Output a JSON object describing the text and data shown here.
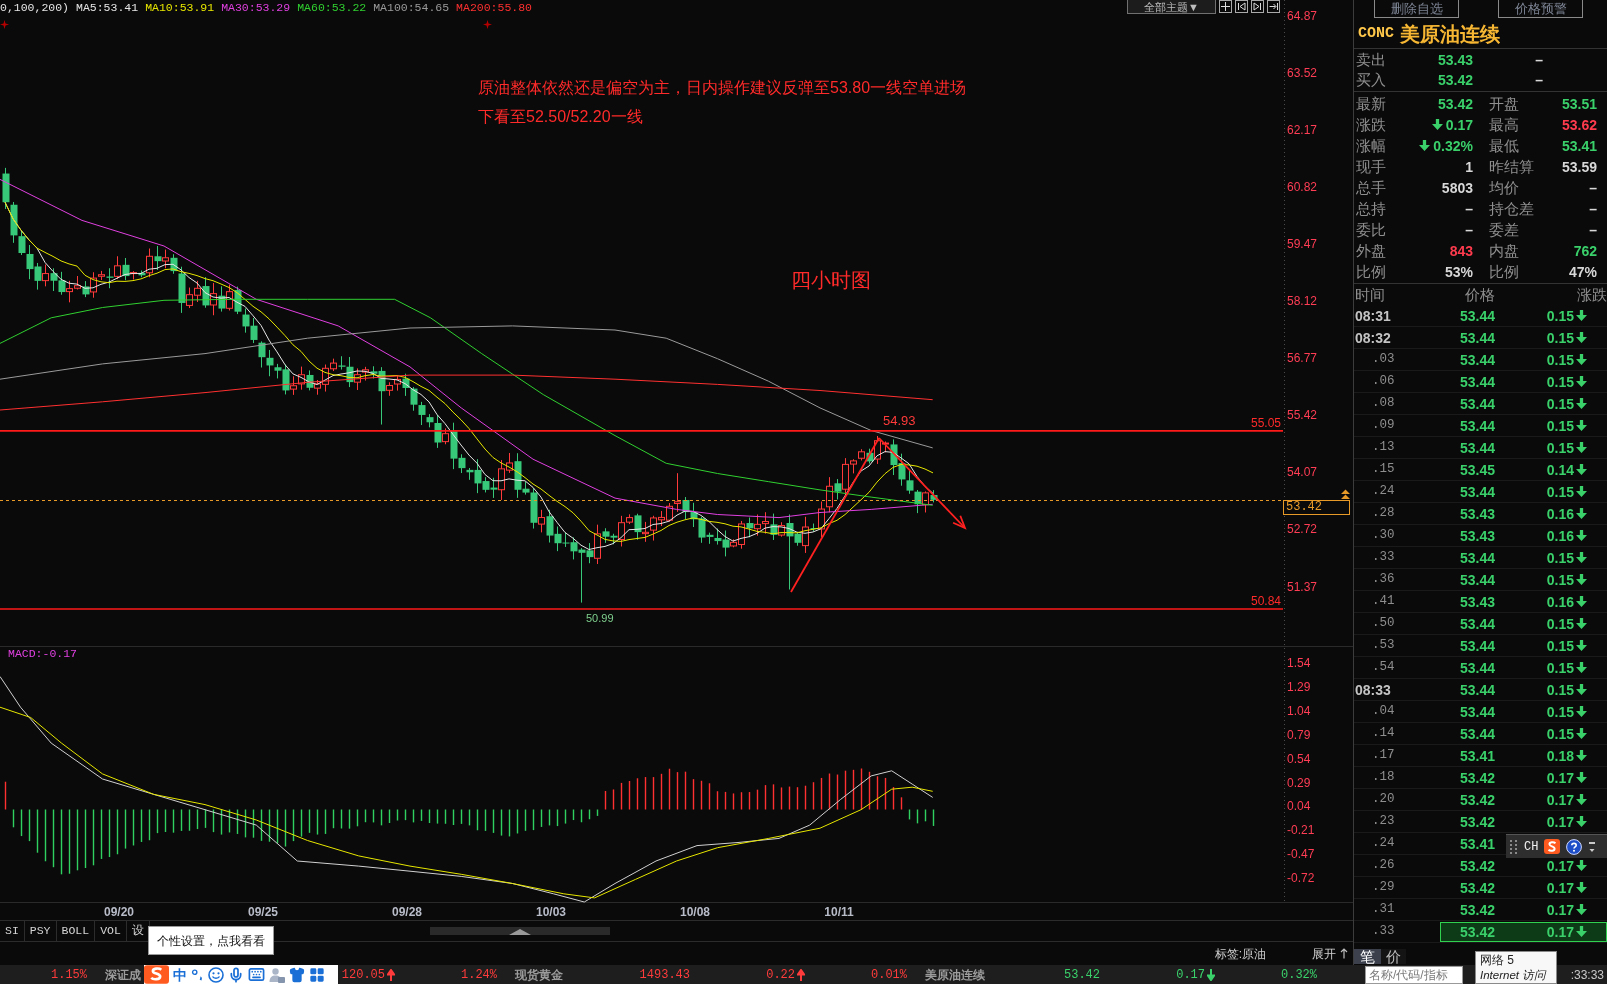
{
  "chart_header": {
    "params": "0,100,200)",
    "moving_averages": [
      {
        "label": "MA5:53.41",
        "color": "#e6e6e6"
      },
      {
        "label": "MA10:53.91",
        "color": "#e6e600"
      },
      {
        "label": "MA30:53.29",
        "color": "#e040e0"
      },
      {
        "label": "MA60:53.22",
        "color": "#30d030"
      },
      {
        "label": "MA100:54.65",
        "color": "#9a9a9a"
      },
      {
        "label": "MA200:55.80",
        "color": "#ff3030"
      }
    ],
    "theme_button": "全部主题▼"
  },
  "notes": [
    "原油整体依然还是偏空为主，日内操作建议反弹至53.80一线空单进场",
    "下看至52.50/52.20一线"
  ],
  "chart_title": "四小时图",
  "price_axis": [
    "64.87",
    "63.52",
    "62.17",
    "60.82",
    "59.47",
    "58.12",
    "56.77",
    "55.42",
    "54.07",
    "52.72",
    "51.37"
  ],
  "levels": [
    {
      "label": "55.05",
      "kind": "resistance"
    },
    {
      "label": "50.84",
      "kind": "support"
    }
  ],
  "extremes": {
    "high": "54.93",
    "low": "50.99"
  },
  "last_price": "53.42",
  "macd": {
    "label": "MACD:-0.17",
    "axis": [
      "1.54",
      "1.29",
      "1.04",
      "0.79",
      "0.54",
      "0.29",
      "0.04",
      "-0.21",
      "-0.47",
      "-0.72"
    ]
  },
  "dates": [
    "09/20",
    "09/25",
    "09/28",
    "10/03",
    "10/08",
    "10/11"
  ],
  "indicator_tabs": [
    "SI",
    "PSY",
    "BOLL",
    "VOL",
    "设"
  ],
  "settings_tooltip": "个性设置，点我看看",
  "tag_label": "标签:原油",
  "expand_button": "展开",
  "quote_panel": {
    "buttons": [
      "删除自选",
      "价格预警"
    ],
    "code": "CONC",
    "name": "美原油连续",
    "book": [
      {
        "label": "卖出",
        "price": "53.43",
        "volume": "–",
        "color": "#3ad16b"
      },
      {
        "label": "买入",
        "price": "53.42",
        "volume": "–",
        "color": "#3ad16b"
      }
    ],
    "stats": [
      {
        "left": {
          "label": "最新",
          "value": "53.42",
          "color": "#3ad16b",
          "arrow": false
        },
        "right": {
          "label": "开盘",
          "value": "53.51",
          "color": "#3ad16b",
          "arrow": false
        }
      },
      {
        "left": {
          "label": "涨跌",
          "value": "0.17",
          "color": "#3ad16b",
          "arrow": true
        },
        "right": {
          "label": "最高",
          "value": "53.62",
          "color": "#ff3b4e",
          "arrow": false
        }
      },
      {
        "left": {
          "label": "涨幅",
          "value": "0.32%",
          "color": "#3ad16b",
          "arrow": true
        },
        "right": {
          "label": "最低",
          "value": "53.41",
          "color": "#3ad16b",
          "arrow": false
        }
      },
      {
        "left": {
          "label": "现手",
          "value": "1",
          "color": "#d8d8d8",
          "arrow": false
        },
        "right": {
          "label": "昨结算",
          "value": "53.59",
          "color": "#d8d8d8",
          "arrow": false
        }
      },
      {
        "left": {
          "label": "总手",
          "value": "5803",
          "color": "#d8d8d8",
          "arrow": false
        },
        "right": {
          "label": "均价",
          "value": "–",
          "color": "#d8d8d8",
          "arrow": false
        }
      },
      {
        "left": {
          "label": "总持",
          "value": "–",
          "color": "#d8d8d8",
          "arrow": false
        },
        "right": {
          "label": "持仓差",
          "value": "–",
          "color": "#d8d8d8",
          "arrow": false
        }
      },
      {
        "left": {
          "label": "委比",
          "value": "–",
          "color": "#d8d8d8",
          "arrow": false
        },
        "right": {
          "label": "委差",
          "value": "–",
          "color": "#d8d8d8",
          "arrow": false
        }
      },
      {
        "left": {
          "label": "外盘",
          "value": "843",
          "color": "#ff3b4e",
          "arrow": false
        },
        "right": {
          "label": "内盘",
          "value": "762",
          "color": "#3ad16b",
          "arrow": false
        }
      },
      {
        "left": {
          "label": "比例",
          "value": "53%",
          "color": "#d8d8d8",
          "arrow": false
        },
        "right": {
          "label": "比例",
          "value": "47%",
          "color": "#d8d8d8",
          "arrow": false
        }
      }
    ]
  },
  "tape": {
    "columns": [
      "时间",
      "价格",
      "涨跌"
    ],
    "rows": [
      {
        "time": "08:31",
        "kind": "minute",
        "price": "53.44",
        "change": "0.15",
        "color": "#3ad16b",
        "rising": false,
        "selected": false
      },
      {
        "time": "08:32",
        "kind": "minute",
        "price": "53.44",
        "change": "0.15",
        "color": "#3ad16b",
        "rising": false,
        "selected": false
      },
      {
        "time": ".03",
        "kind": "tick",
        "price": "53.44",
        "change": "0.15",
        "color": "#3ad16b",
        "rising": false,
        "selected": false
      },
      {
        "time": ".06",
        "kind": "tick",
        "price": "53.44",
        "change": "0.15",
        "color": "#3ad16b",
        "rising": false,
        "selected": false
      },
      {
        "time": ".08",
        "kind": "tick",
        "price": "53.44",
        "change": "0.15",
        "color": "#3ad16b",
        "rising": false,
        "selected": false
      },
      {
        "time": ".09",
        "kind": "tick",
        "price": "53.44",
        "change": "0.15",
        "color": "#3ad16b",
        "rising": false,
        "selected": false
      },
      {
        "time": ".13",
        "kind": "tick",
        "price": "53.44",
        "change": "0.15",
        "color": "#3ad16b",
        "rising": false,
        "selected": false
      },
      {
        "time": ".15",
        "kind": "tick",
        "price": "53.45",
        "change": "0.14",
        "color": "#3ad16b",
        "rising": false,
        "selected": false
      },
      {
        "time": ".24",
        "kind": "tick",
        "price": "53.44",
        "change": "0.15",
        "color": "#3ad16b",
        "rising": false,
        "selected": false
      },
      {
        "time": ".28",
        "kind": "tick",
        "price": "53.43",
        "change": "0.16",
        "color": "#3ad16b",
        "rising": false,
        "selected": false
      },
      {
        "time": ".30",
        "kind": "tick",
        "price": "53.43",
        "change": "0.16",
        "color": "#3ad16b",
        "rising": false,
        "selected": false
      },
      {
        "time": ".33",
        "kind": "tick",
        "price": "53.44",
        "change": "0.15",
        "color": "#3ad16b",
        "rising": false,
        "selected": false
      },
      {
        "time": ".36",
        "kind": "tick",
        "price": "53.44",
        "change": "0.15",
        "color": "#3ad16b",
        "rising": false,
        "selected": false
      },
      {
        "time": ".41",
        "kind": "tick",
        "price": "53.43",
        "change": "0.16",
        "color": "#3ad16b",
        "rising": false,
        "selected": false
      },
      {
        "time": ".50",
        "kind": "tick",
        "price": "53.44",
        "change": "0.15",
        "color": "#3ad16b",
        "rising": false,
        "selected": false
      },
      {
        "time": ".53",
        "kind": "tick",
        "price": "53.44",
        "change": "0.15",
        "color": "#3ad16b",
        "rising": false,
        "selected": false
      },
      {
        "time": ".54",
        "kind": "tick",
        "price": "53.44",
        "change": "0.15",
        "color": "#3ad16b",
        "rising": false,
        "selected": false
      },
      {
        "time": "08:33",
        "kind": "minute",
        "price": "53.44",
        "change": "0.15",
        "color": "#3ad16b",
        "rising": false,
        "selected": false
      },
      {
        "time": ".04",
        "kind": "tick",
        "price": "53.44",
        "change": "0.15",
        "color": "#3ad16b",
        "rising": false,
        "selected": false
      },
      {
        "time": ".14",
        "kind": "tick",
        "price": "53.44",
        "change": "0.15",
        "color": "#3ad16b",
        "rising": false,
        "selected": false
      },
      {
        "time": ".17",
        "kind": "tick",
        "price": "53.41",
        "change": "0.18",
        "color": "#3ad16b",
        "rising": false,
        "selected": false
      },
      {
        "time": ".18",
        "kind": "tick",
        "price": "53.42",
        "change": "0.17",
        "color": "#3ad16b",
        "rising": false,
        "selected": false
      },
      {
        "time": ".20",
        "kind": "tick",
        "price": "53.42",
        "change": "0.17",
        "color": "#3ad16b",
        "rising": false,
        "selected": false
      },
      {
        "time": ".23",
        "kind": "tick",
        "price": "53.42",
        "change": "0.17",
        "color": "#3ad16b",
        "rising": false,
        "selected": false
      },
      {
        "time": ".24",
        "kind": "tick",
        "price": "53.41",
        "color": "#3ad16b",
        "selected": false
      },
      {
        "time": ".26",
        "kind": "tick",
        "price": "53.42",
        "change": "0.17",
        "color": "#3ad16b",
        "rising": false,
        "selected": false
      },
      {
        "time": ".29",
        "kind": "tick",
        "price": "53.42",
        "change": "0.17",
        "color": "#3ad16b",
        "rising": false,
        "selected": false
      },
      {
        "time": ".31",
        "kind": "tick",
        "price": "53.42",
        "change": "0.17",
        "color": "#3ad16b",
        "rising": false,
        "selected": false
      },
      {
        "time": ".33",
        "kind": "tick",
        "price": "53.42",
        "change": "0.17",
        "color": "#3ad16b",
        "rising": false,
        "selected": true
      }
    ]
  },
  "list_tabs": [
    {
      "label": "笔",
      "selected": true
    },
    {
      "label": "价",
      "selected": false
    }
  ],
  "status_bar": {
    "tickers": [
      {
        "pct": "1.15%",
        "color": "#ff3b3b"
      },
      {
        "name": "深证成",
        "change": "120.05",
        "pct": "1.24%",
        "color": "#ff3b3b",
        "rising": true
      },
      {
        "name": "现货黄金",
        "price": "1493.43",
        "change": "0.22",
        "pct": "0.01%",
        "color": "#ff3b3b",
        "rising": true
      },
      {
        "name": "美原油连续",
        "price": "53.42",
        "change": "0.17",
        "pct": "0.32%",
        "color": "#3ad16b",
        "rising": false
      }
    ],
    "clock": ":33:33"
  },
  "ime_toolbar": {
    "mode": "中"
  },
  "ime_floating_bar": {
    "language": "CH"
  },
  "search_field": {
    "placeholder": "名称/代码/指标"
  },
  "network_tooltip": {
    "title": "网络 5",
    "subtitle": "Internet 访问"
  }
}
